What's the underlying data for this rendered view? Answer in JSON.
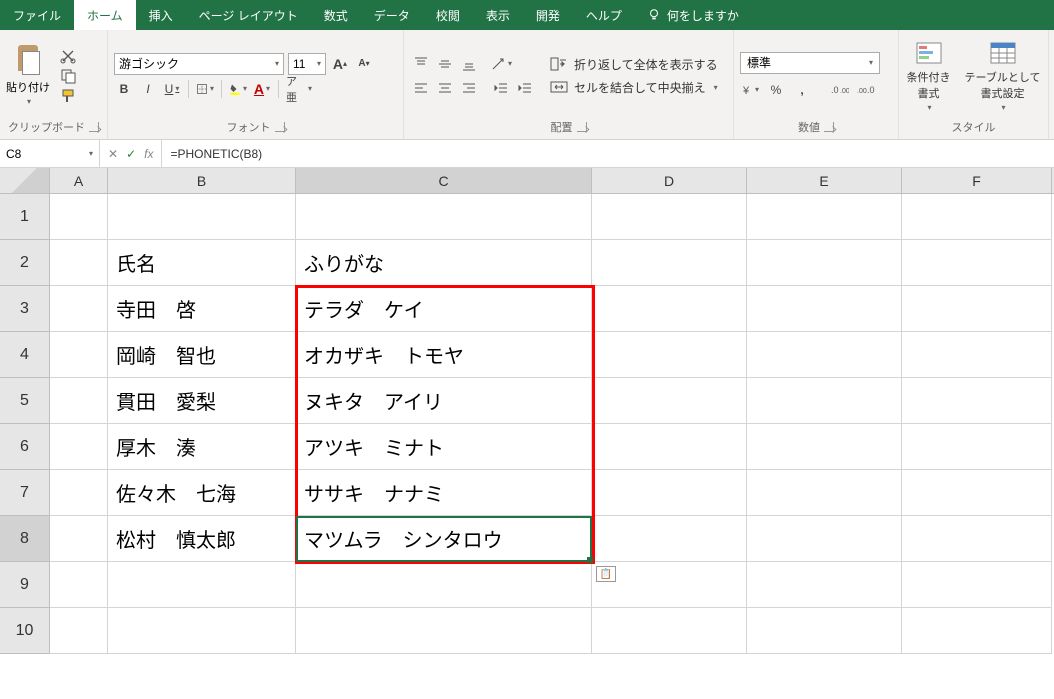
{
  "tabs": {
    "file": "ファイル",
    "home": "ホーム",
    "insert": "挿入",
    "pagelayout": "ページ レイアウト",
    "formulas": "数式",
    "data": "データ",
    "review": "校閲",
    "view": "表示",
    "developer": "開発",
    "help": "ヘルプ",
    "tellme": "何をしますか"
  },
  "ribbon": {
    "clipboard": {
      "paste": "貼り付け",
      "label": "クリップボード"
    },
    "font": {
      "name": "游ゴシック",
      "size": "11",
      "bold": "B",
      "italic": "I",
      "underline": "U",
      "label": "フォント",
      "ruby": "ア亜"
    },
    "alignment": {
      "wrap": "折り返して全体を表示する",
      "merge": "セルを結合して中央揃え",
      "label": "配置"
    },
    "number": {
      "format": "標準",
      "label": "数値"
    },
    "styles": {
      "conditional": "条件付き\n書式",
      "table": "テーブルとして\n書式設定",
      "label": "スタイル"
    }
  },
  "nameBox": "C8",
  "formula": "=PHONETIC(B8)",
  "columns": [
    "A",
    "B",
    "C",
    "D",
    "E",
    "F"
  ],
  "rowNums": [
    "1",
    "2",
    "3",
    "4",
    "5",
    "6",
    "7",
    "8",
    "9",
    "10"
  ],
  "cells": {
    "B2": "氏名",
    "C2": "ふりがな",
    "B3": "寺田　啓",
    "C3": "テラダ　ケイ",
    "B4": "岡崎　智也",
    "C4": "オカザキ　トモヤ",
    "B5": "貫田　愛梨",
    "C5": "ヌキタ　アイリ",
    "B6": "厚木　湊",
    "C6": "アツキ　ミナト",
    "B7": "佐々木　七海",
    "C7": "ササキ　ナナミ",
    "B8": "松村　慎太郎",
    "C8": "マツムラ　シンタロウ"
  },
  "chart_data": {
    "type": "table",
    "columns": [
      "氏名",
      "ふりがな"
    ],
    "rows": [
      [
        "寺田　啓",
        "テラダ　ケイ"
      ],
      [
        "岡崎　智也",
        "オカザキ　トモヤ"
      ],
      [
        "貫田　愛梨",
        "ヌキタ　アイリ"
      ],
      [
        "厚木　湊",
        "アツキ　ミナト"
      ],
      [
        "佐々木　七海",
        "ササキ　ナナミ"
      ],
      [
        "松村　慎太郎",
        "マツムラ　シンタロウ"
      ]
    ]
  }
}
